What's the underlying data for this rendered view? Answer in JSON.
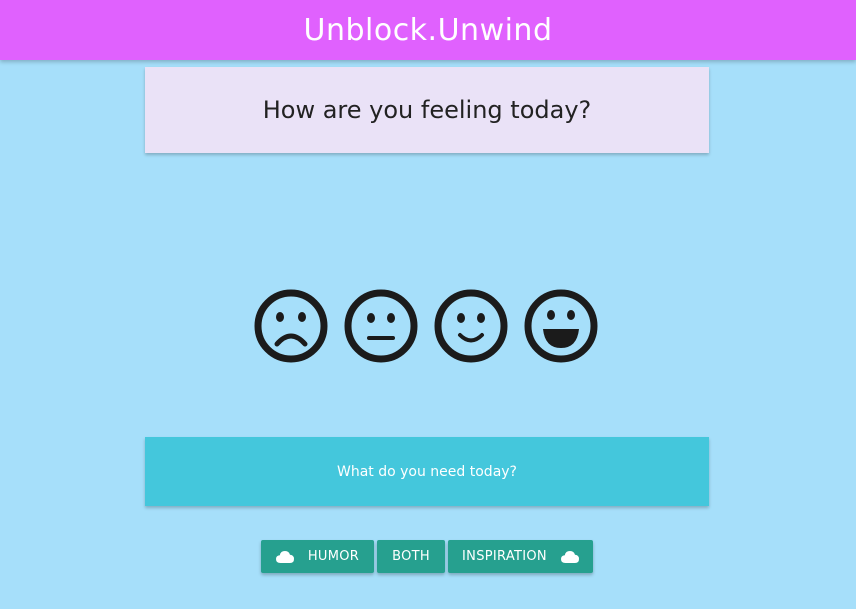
{
  "navbar": {
    "brand": "Unblock.Unwind"
  },
  "question_card": {
    "title": "How are you feeling today?"
  },
  "moods": [
    {
      "icon": "sad-face-icon"
    },
    {
      "icon": "neutral-face-icon"
    },
    {
      "icon": "smile-face-icon"
    },
    {
      "icon": "grin-face-icon"
    }
  ],
  "need_card": {
    "text": "What do you need today?"
  },
  "buttons": {
    "humor": "HUMOR",
    "both": "BOTH",
    "inspiration": "INSPIRATION"
  },
  "colors": {
    "page_bg": "#a6dffa",
    "navbar": "#e061fe",
    "question_card": "#eae2f7",
    "need_card": "#44c7dc",
    "button": "#26a08f"
  }
}
